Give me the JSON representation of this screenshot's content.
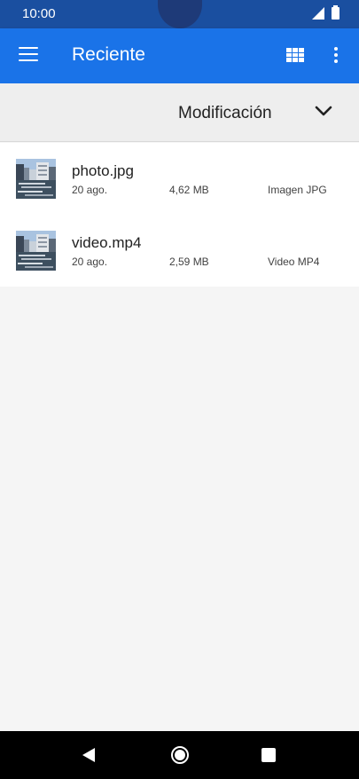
{
  "status_bar": {
    "time": "10:00",
    "icons": [
      "signal-icon",
      "battery-icon"
    ]
  },
  "app_bar": {
    "title": "Reciente",
    "icons": [
      "menu-icon",
      "grid-view-icon",
      "more-options-icon"
    ]
  },
  "sort": {
    "label": "Modificación",
    "icon": "chevron-down-icon"
  },
  "files": [
    {
      "name": "photo.jpg",
      "date": "20 ago.",
      "size": "4,62 MB",
      "type": "Imagen JPG",
      "thumbnail": "harbor-photo-thumbnail"
    },
    {
      "name": "video.mp4",
      "date": "20 ago.",
      "size": "2,59 MB",
      "type": "Video MP4",
      "thumbnail": "harbor-video-thumbnail"
    }
  ],
  "nav_bar": {
    "icons": [
      "back-icon",
      "home-icon",
      "recent-apps-icon"
    ]
  },
  "colors": {
    "app_bar": "#1a73e8",
    "status_bar": "#1a4fa0",
    "background": "#f5f5f5",
    "sort_bar": "#eeeeee"
  }
}
